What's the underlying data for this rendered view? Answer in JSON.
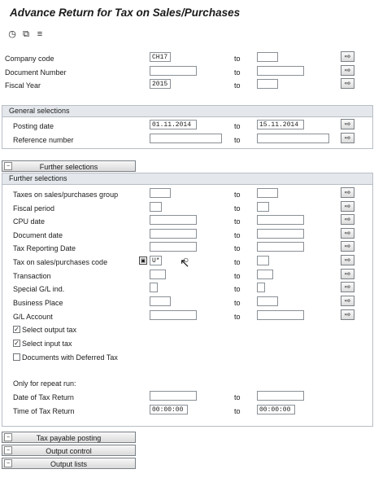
{
  "title": "Advance Return for Tax on Sales/Purchases",
  "toolbar": {
    "icons": [
      "execute-icon",
      "save-variant-icon",
      "variant-list-icon"
    ]
  },
  "arrow_symbol": "⇨",
  "to_label": "to",
  "top_fields": [
    {
      "label": "Company code",
      "from": "CH17",
      "to": ""
    },
    {
      "label": "Document Number",
      "from": "",
      "to": ""
    },
    {
      "label": "Fiscal Year",
      "from": "2015",
      "to": ""
    }
  ],
  "general": {
    "header": "General selections",
    "fields": [
      {
        "label": "Posting date",
        "from": "01.11.2014",
        "to": "15.11.2014"
      },
      {
        "label": "Reference number",
        "from": "",
        "to": ""
      }
    ]
  },
  "further_button": "Further selections",
  "further": {
    "header": "Further selections",
    "fields": [
      {
        "label": "Taxes on sales/purchases group",
        "from": "",
        "to": ""
      },
      {
        "label": "Fiscal period",
        "from": "",
        "to": ""
      },
      {
        "label": "CPU date",
        "from": "",
        "to": ""
      },
      {
        "label": "Document date",
        "from": "",
        "to": ""
      },
      {
        "label": "Tax Reporting Date",
        "from": "",
        "to": ""
      },
      {
        "label": "Tax on sales/purchases code",
        "from": "U*",
        "to": ""
      },
      {
        "label": "Transaction",
        "from": "",
        "to": ""
      },
      {
        "label": "Special G/L ind.",
        "from": "",
        "to": ""
      },
      {
        "label": "Business Place",
        "from": "",
        "to": ""
      },
      {
        "label": "G/L Account",
        "from": "",
        "to": ""
      }
    ],
    "checkboxes": [
      {
        "label": "Select output tax",
        "checked": "✓"
      },
      {
        "label": "Select input tax",
        "checked": "✓"
      },
      {
        "label": "Documents with Deferred Tax",
        "checked": ""
      }
    ],
    "repeat_run": {
      "label": "Only for repeat run:",
      "fields": [
        {
          "label": "Date of Tax Return",
          "from": "",
          "to": ""
        },
        {
          "label": "Time of Tax Return",
          "from": "00:00:00",
          "to": "00:00:00"
        }
      ]
    }
  },
  "bottom_buttons": [
    "Tax payable posting",
    "Output control",
    "Output lists"
  ]
}
